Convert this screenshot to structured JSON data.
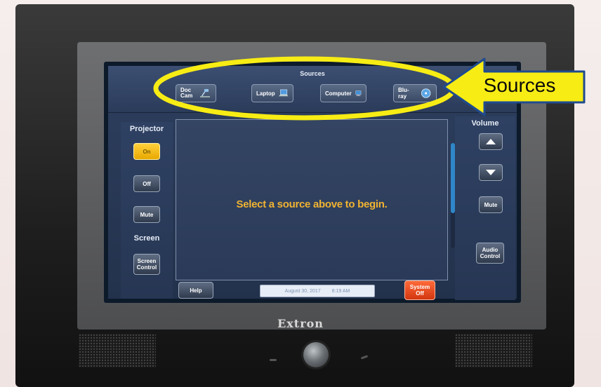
{
  "device": {
    "brand": "Extron"
  },
  "sources_bar": {
    "title": "Sources",
    "items": [
      {
        "label": "Doc Cam",
        "icon": "document-camera-icon"
      },
      {
        "label": "Laptop",
        "icon": "laptop-icon"
      },
      {
        "label": "Computer",
        "icon": "computer-icon"
      },
      {
        "label": "Blu-ray",
        "icon": "disc-icon"
      }
    ]
  },
  "left_panel": {
    "projector_heading": "Projector",
    "projector_buttons": {
      "on": "On",
      "off": "Off",
      "mute": "Mute"
    },
    "screen_heading": "Screen",
    "screen_control": "Screen Control"
  },
  "right_panel": {
    "volume_heading": "Volume",
    "mute": "Mute",
    "audio_control": "Audio Control"
  },
  "main": {
    "prompt": "Select a source above to begin."
  },
  "bottom_bar": {
    "help": "Help",
    "date": "August 30, 2017",
    "time": "8:19 AM",
    "system_off": "System Off"
  },
  "annotation": {
    "label": "Sources",
    "highlight_color": "#f7ec14",
    "arrow_fill": "#f7ec14",
    "arrow_outline": "#1f4b8f"
  },
  "colors": {
    "active_button": "#ffd13b",
    "system_off": "#e8461c",
    "prompt_text": "#f0b332",
    "scroll_thumb": "#2f86c9"
  }
}
